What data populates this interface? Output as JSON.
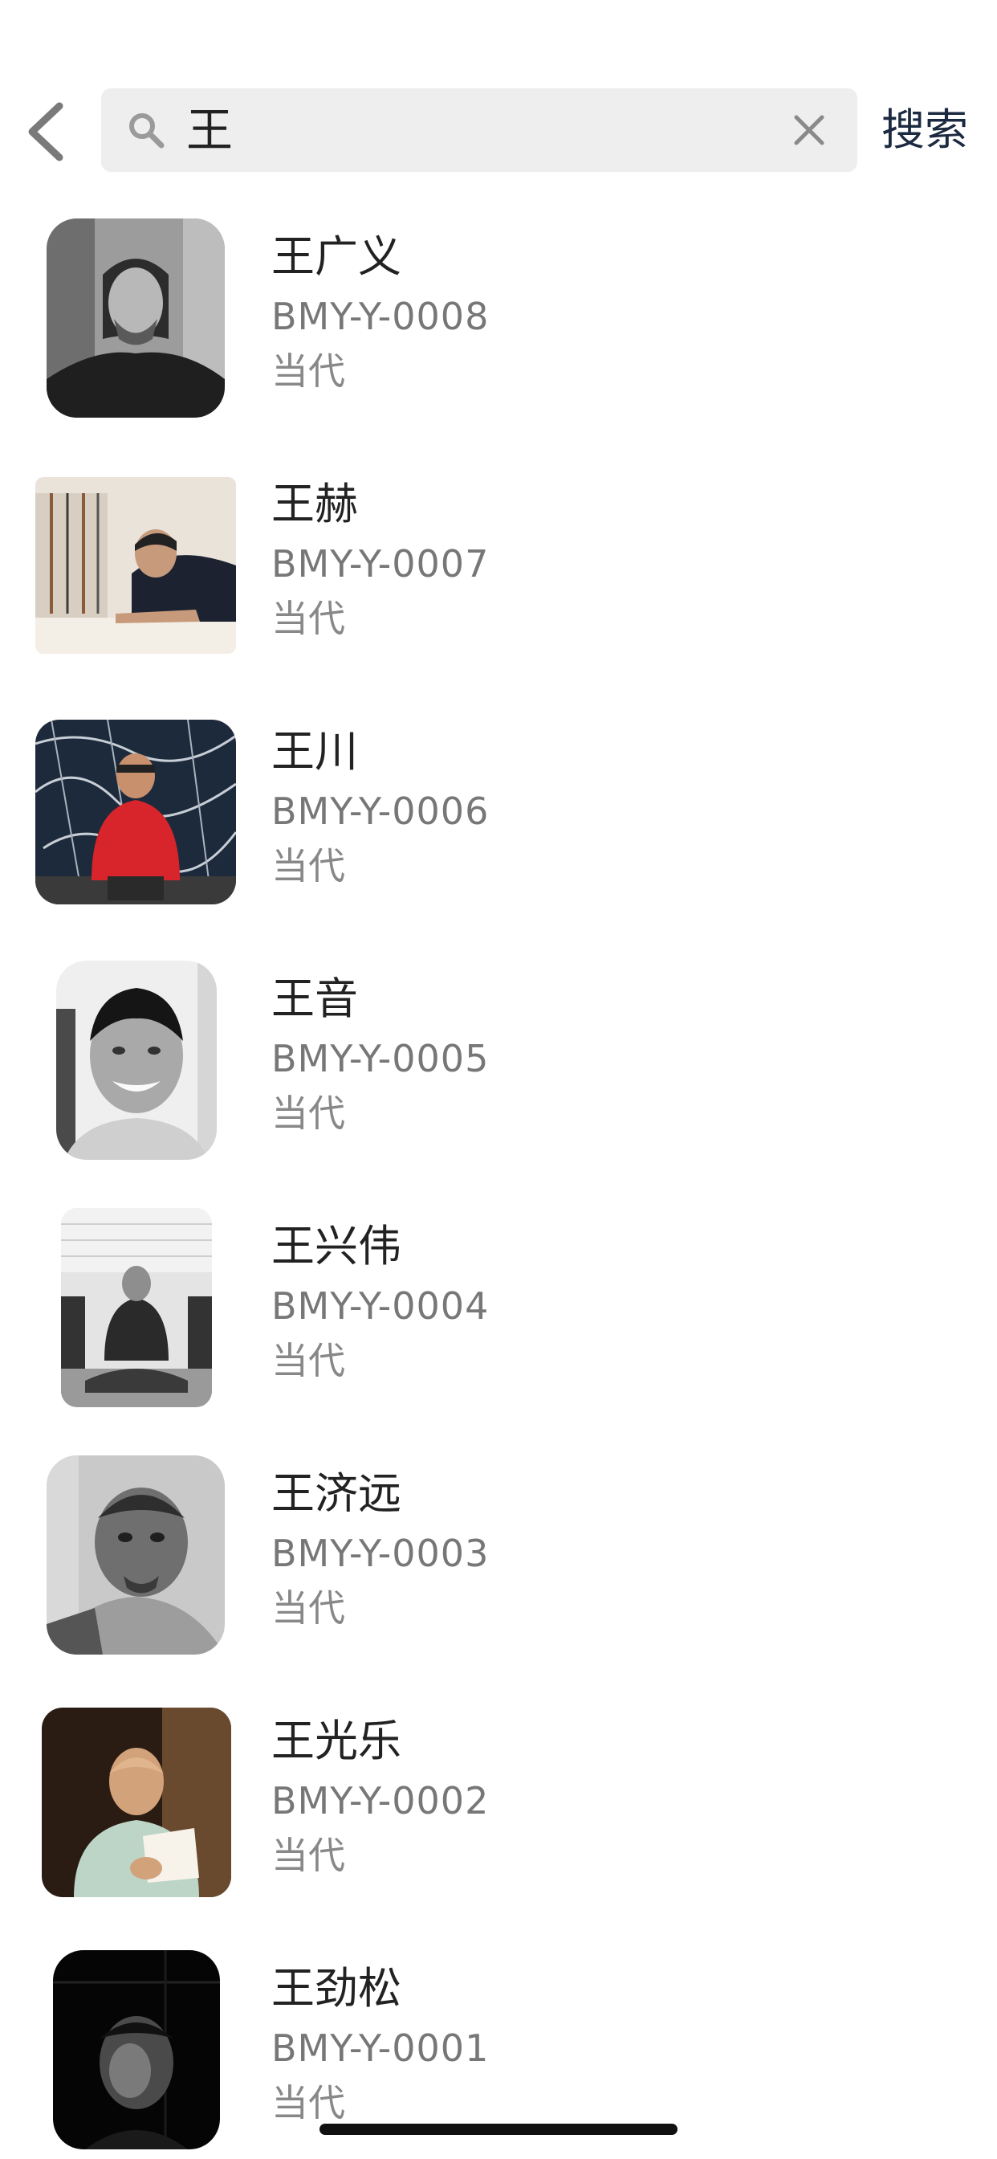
{
  "search": {
    "value": "王",
    "button_label": "搜索"
  },
  "results": [
    {
      "name": "王广义",
      "code": "BMY-Y-0008",
      "era": "当代"
    },
    {
      "name": "王赫",
      "code": "BMY-Y-0007",
      "era": "当代"
    },
    {
      "name": "王川",
      "code": "BMY-Y-0006",
      "era": "当代"
    },
    {
      "name": "王音",
      "code": "BMY-Y-0005",
      "era": "当代"
    },
    {
      "name": "王兴伟",
      "code": "BMY-Y-0004",
      "era": "当代"
    },
    {
      "name": "王济远",
      "code": "BMY-Y-0003",
      "era": "当代"
    },
    {
      "name": "王光乐",
      "code": "BMY-Y-0002",
      "era": "当代"
    },
    {
      "name": "王劲松",
      "code": "BMY-Y-0001",
      "era": "当代"
    }
  ],
  "icons": {
    "back": "chevron-left-icon",
    "search": "search-icon",
    "clear": "close-icon"
  },
  "colors": {
    "search_field_bg": "#eeeeee",
    "search_button_text": "#1b2a40",
    "primary_text": "#222222",
    "secondary_text": "#777777"
  }
}
